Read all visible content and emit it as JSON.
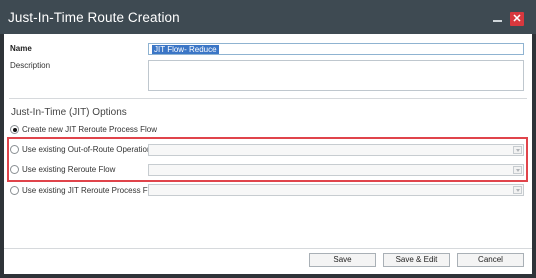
{
  "window": {
    "title": "Just-In-Time Route Creation",
    "close_glyph": "✕"
  },
  "form": {
    "name_label": "Name",
    "name_value": "JIT Flow- Reduce",
    "description_label": "Description",
    "description_value": ""
  },
  "jit": {
    "section_title": "Just-In-Time (JIT) Options",
    "options": [
      {
        "label": "Create new JIT Reroute Process Flow",
        "selected": true
      },
      {
        "label": "Use existing Out-of-Route Operation",
        "selected": false
      },
      {
        "label": "Use existing Reroute Flow",
        "selected": false
      },
      {
        "label": "Use existing JIT Reroute Process Flow",
        "selected": false
      }
    ]
  },
  "buttons": {
    "save": "Save",
    "save_edit": "Save & Edit",
    "cancel": "Cancel"
  },
  "colors": {
    "titlebar": "#3e4a52",
    "highlight": "#e0444b",
    "close": "#d8383e",
    "selection": "#3b76c6"
  }
}
